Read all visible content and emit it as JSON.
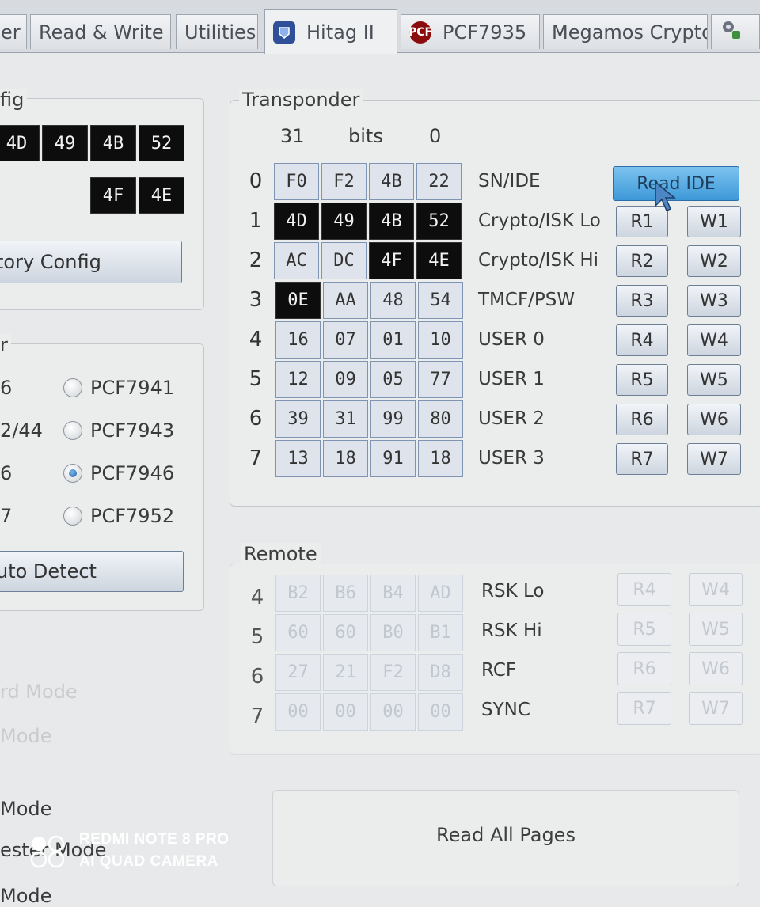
{
  "tabs": [
    {
      "label": "er",
      "icon": ""
    },
    {
      "label": "Read & Write",
      "icon": ""
    },
    {
      "label": "Utilities",
      "icon": ""
    },
    {
      "label": "Hitag II",
      "icon": "hitag-icon",
      "active": true
    },
    {
      "label": "PCF7935",
      "icon": "pcf-icon",
      "icon_text": "PCF"
    },
    {
      "label": "Megamos Crypto",
      "icon": ""
    },
    {
      "label": "",
      "icon": "tools-icon"
    }
  ],
  "left": {
    "config_legend": "fig",
    "config_row1": [
      "4D",
      "49",
      "4B",
      "52"
    ],
    "config_row2": [
      "4F",
      "4E"
    ],
    "factory_button": "tory Config",
    "type_legend": "r",
    "radios": [
      {
        "prefix": "6",
        "label": "PCF7941",
        "checked": false
      },
      {
        "prefix": "2/44",
        "label": "PCF7943",
        "checked": false
      },
      {
        "prefix": "6",
        "label": "PCF7946",
        "checked": true
      },
      {
        "prefix": "7",
        "label": "PCF7952",
        "checked": false
      }
    ],
    "auto_detect_button": "uto Detect",
    "modes": [
      "rd Mode",
      "Mode",
      "Mode",
      "ester Mode",
      "Mode"
    ]
  },
  "transponder": {
    "legend": "Transponder",
    "header": {
      "left": "31",
      "mid": "bits",
      "right": "0"
    },
    "rows": [
      {
        "num": "0",
        "bytes": [
          "F0",
          "F2",
          "4B",
          "22"
        ],
        "dark": [
          false,
          false,
          false,
          false
        ],
        "label": "SN/IDE"
      },
      {
        "num": "1",
        "bytes": [
          "4D",
          "49",
          "4B",
          "52"
        ],
        "dark": [
          true,
          true,
          true,
          true
        ],
        "label": "Crypto/ISK Lo",
        "read": "R1",
        "write": "W1"
      },
      {
        "num": "2",
        "bytes": [
          "AC",
          "DC",
          "4F",
          "4E"
        ],
        "dark": [
          false,
          false,
          true,
          true
        ],
        "label": "Crypto/ISK Hi",
        "read": "R2",
        "write": "W2"
      },
      {
        "num": "3",
        "bytes": [
          "0E",
          "AA",
          "48",
          "54"
        ],
        "dark": [
          true,
          false,
          false,
          false
        ],
        "label": "TMCF/PSW",
        "read": "R3",
        "write": "W3"
      },
      {
        "num": "4",
        "bytes": [
          "16",
          "07",
          "01",
          "10"
        ],
        "dark": [
          false,
          false,
          false,
          false
        ],
        "label": "USER 0",
        "read": "R4",
        "write": "W4"
      },
      {
        "num": "5",
        "bytes": [
          "12",
          "09",
          "05",
          "77"
        ],
        "dark": [
          false,
          false,
          false,
          false
        ],
        "label": "USER 1",
        "read": "R5",
        "write": "W5"
      },
      {
        "num": "6",
        "bytes": [
          "39",
          "31",
          "99",
          "80"
        ],
        "dark": [
          false,
          false,
          false,
          false
        ],
        "label": "USER 2",
        "read": "R6",
        "write": "W6"
      },
      {
        "num": "7",
        "bytes": [
          "13",
          "18",
          "91",
          "18"
        ],
        "dark": [
          false,
          false,
          false,
          false
        ],
        "label": "USER 3",
        "read": "R7",
        "write": "W7"
      }
    ],
    "read_ide_button": "Read IDE"
  },
  "remote": {
    "legend": "Remote",
    "rows": [
      {
        "num": "4",
        "bytes": [
          "B2",
          "B6",
          "B4",
          "AD"
        ],
        "label": "RSK Lo",
        "read": "R4",
        "write": "W4"
      },
      {
        "num": "5",
        "bytes": [
          "60",
          "60",
          "B0",
          "B1"
        ],
        "label": "RSK Hi",
        "read": "R5",
        "write": "W5"
      },
      {
        "num": "6",
        "bytes": [
          "27",
          "21",
          "F2",
          "D8"
        ],
        "label": "RCF",
        "read": "R6",
        "write": "W6"
      },
      {
        "num": "7",
        "bytes": [
          "00",
          "00",
          "00",
          "00"
        ],
        "label": "SYNC",
        "read": "R7",
        "write": "W7"
      }
    ]
  },
  "read_all_button": "Read All Pages",
  "watermark": {
    "line1": "REDMI NOTE 8 PRO",
    "line2": "AI QUAD CAMERA"
  }
}
